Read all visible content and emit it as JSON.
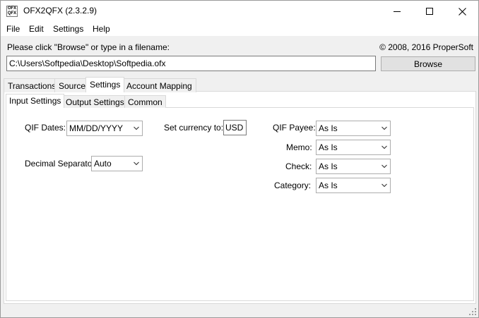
{
  "window": {
    "title": "OFX2QFX (2.3.2.9)",
    "icon_text_top": "OFX",
    "icon_text_bottom": "QFX"
  },
  "menu": {
    "items": [
      {
        "label": "File"
      },
      {
        "label": "Edit"
      },
      {
        "label": "Settings"
      },
      {
        "label": "Help"
      }
    ]
  },
  "header": {
    "browse_prompt": "Please click \"Browse\" or type in a filename:",
    "copyright": "© 2008, 2016 ProperSoft"
  },
  "file": {
    "path": "C:\\Users\\Softpedia\\Desktop\\Softpedia.ofx",
    "browse_label": "Browse"
  },
  "tabs": [
    {
      "label": "Transactions"
    },
    {
      "label": "Source"
    },
    {
      "label": "Settings",
      "active": true
    },
    {
      "label": "Account Mapping"
    }
  ],
  "subtabs": [
    {
      "label": "Input Settings",
      "active": true
    },
    {
      "label": "Output Settings"
    },
    {
      "label": "Common"
    }
  ],
  "input_settings": {
    "qif_dates_label": "QIF Dates:",
    "qif_dates_value": "MM/DD/YYYY",
    "decimal_separator_label": "Decimal Separator:",
    "decimal_separator_value": "Auto",
    "set_currency_label": "Set currency to:",
    "currency_value": "USD",
    "qif_payee_label": "QIF Payee:",
    "qif_payee_value": "As Is",
    "memo_label": "Memo:",
    "memo_value": "As Is",
    "check_label": "Check:",
    "check_value": "As Is",
    "category_label": "Category:",
    "category_value": "As Is"
  },
  "icons": {
    "minimize": "minimize-icon",
    "maximize": "maximize-icon",
    "close": "close-icon",
    "dropdown": "chevron-down-icon",
    "grip": "resize-grip-icon"
  }
}
